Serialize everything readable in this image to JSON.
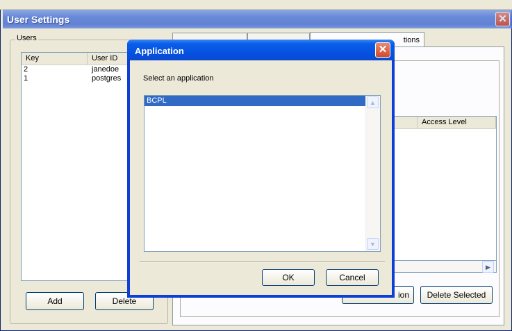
{
  "window": {
    "title": "User Settings"
  },
  "users_panel": {
    "legend": "Users",
    "columns": [
      "Key",
      "User ID"
    ],
    "rows": [
      {
        "key": "2",
        "user_id": "janedoe"
      },
      {
        "key": "1",
        "user_id": "postgres"
      }
    ],
    "add_label": "Add",
    "delete_label": "Delete"
  },
  "right_panel": {
    "tab_label_visible": "tions",
    "access_level_header": "Access Level",
    "add_application_partial": "ion",
    "delete_selected_label": "Delete Selected"
  },
  "dialog": {
    "title": "Application",
    "prompt": "Select an application",
    "applications": [
      "BCPL"
    ],
    "ok_label": "OK",
    "cancel_label": "Cancel"
  },
  "colors": {
    "selection": "#316ac5",
    "title_blue": "#0a5fe8",
    "close_red": "#d24a2c"
  }
}
